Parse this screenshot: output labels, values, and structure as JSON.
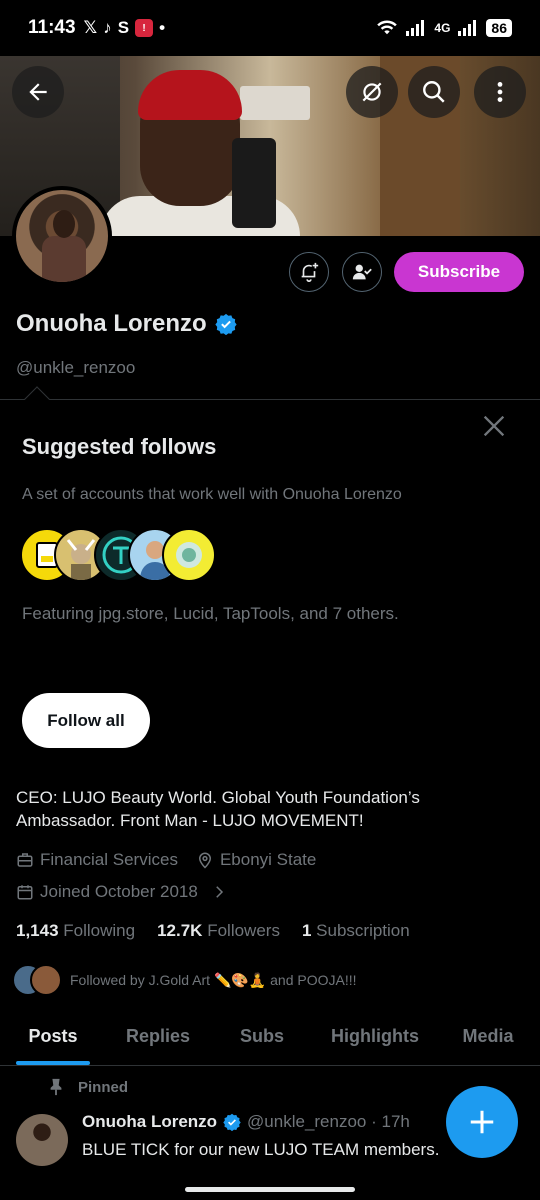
{
  "status_bar": {
    "time": "11:43",
    "left_icons": [
      "x-logo",
      "tiktok",
      "s-app",
      "notification-badge",
      "dot"
    ],
    "battery": "86",
    "network": "4G"
  },
  "header": {
    "back_icon": "arrow-left-icon",
    "icons": [
      "sync-off-icon",
      "search-icon",
      "more-vertical-icon"
    ]
  },
  "profile": {
    "name": "Onuoha Lorenzo",
    "handle": "@unkle_renzoo",
    "subscribe_label": "Subscribe",
    "bio": "CEO: LUJO Beauty World. Global Youth Foundation’s Ambassador. Front Man - LUJO MOVEMENT!",
    "category": "Financial Services",
    "location": "Ebonyi State",
    "joined": "Joined October 2018",
    "following_count": "1,143",
    "following_label": "Following",
    "followers_count": "12.7K",
    "followers_label": "Followers",
    "subscription_count": "1",
    "subscription_label": "Subscription",
    "followed_by": "Followed by J.Gold Art ✏️🎨🧘 and POOJA!!!"
  },
  "suggested": {
    "title": "Suggested follows",
    "description": "A set of accounts that work well with Onuoha Lorenzo",
    "featuring": "Featuring jpg.store, Lucid, TapTools, and 7 others.",
    "follow_all_label": "Follow all"
  },
  "tabs": [
    {
      "label": "Posts",
      "active": true
    },
    {
      "label": "Replies",
      "active": false
    },
    {
      "label": "Subs",
      "active": false
    },
    {
      "label": "Highlights",
      "active": false
    },
    {
      "label": "Media",
      "active": false
    }
  ],
  "post": {
    "pinned_label": "Pinned",
    "author": "Onuoha Lorenzo",
    "handle_time": "@unkle_renzoo · 17h",
    "text": "BLUE TICK for our new LUJO TEAM members."
  },
  "colors": {
    "accent": "#1d9bf0",
    "subscribe": "#c936d1",
    "muted": "#71767b"
  }
}
